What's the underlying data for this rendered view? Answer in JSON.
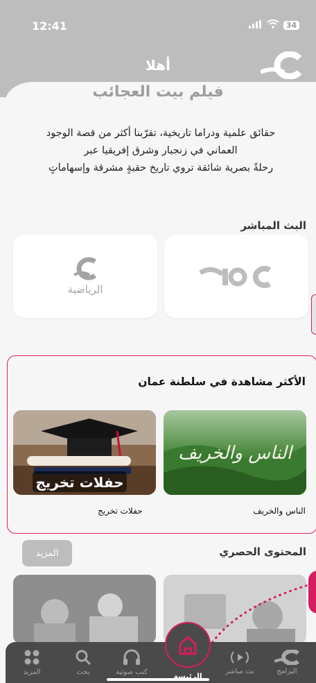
{
  "status": {
    "time": "12:41",
    "battery": "34"
  },
  "header": {
    "title": "أهلا"
  },
  "featured": {
    "title": "فيلم بيت العجائب",
    "description_lines": [
      "حقائق علمية ودراما تاريخية، تقرّبنا أكثر من قصة الوجود",
      "العماني في زنجبار وشرق إفريقيا عبر",
      "رحلةً بصرية شائقة تروي تاريخ حقبةٍ مشرقة وإسهاماتٍ"
    ]
  },
  "live": {
    "title": "البث المباشر",
    "channels": [
      {
        "name": "oman tv",
        "logo_text": "oman"
      },
      {
        "name": "الرياضية",
        "logo_text": "الرياضية"
      }
    ]
  },
  "most_watched": {
    "title": "الأكثر مشاهدة في سلطنة عمان",
    "items": [
      {
        "caption": "الناس والخريف",
        "art_text": "الناس والخريف"
      },
      {
        "caption": "حفلات تخريج",
        "art_text": "حفلات تخريج"
      }
    ]
  },
  "exclusive": {
    "title": "المحتوى الحصري",
    "more_label": "المزيد"
  },
  "tabs": [
    {
      "label": "البرامج",
      "icon": "oman-logo-icon"
    },
    {
      "label": "بث مباشر",
      "icon": "live-broadcast-icon"
    },
    {
      "label": "الرئيسة",
      "icon": "home-icon"
    },
    {
      "label": "كتب صوتية",
      "icon": "headphones-icon"
    },
    {
      "label": "بحث",
      "icon": "search-icon"
    },
    {
      "label": "المزيد",
      "icon": "more-grid-icon"
    }
  ],
  "colors": {
    "accent": "#d51d5f",
    "header": "#bdbdbd",
    "tabbar": "#4a4a4a"
  }
}
